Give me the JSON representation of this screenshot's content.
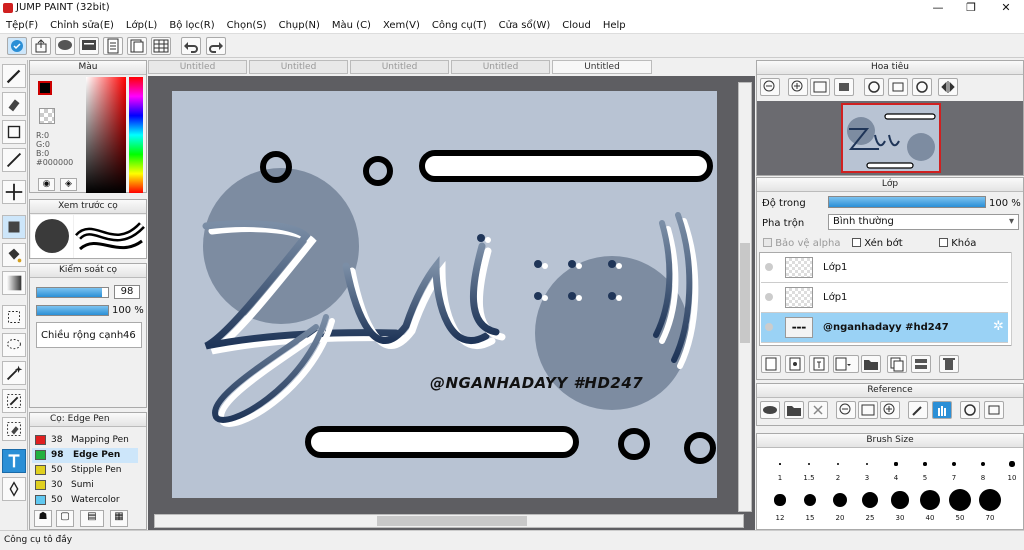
{
  "app": {
    "title": "JUMP PAINT (32bit)"
  },
  "window": {
    "minimize": "—",
    "maximize": "❐",
    "close": "✕"
  },
  "menu": [
    "Tệp(F)",
    "Chỉnh sửa(E)",
    "Lớp(L)",
    "Bộ lọc(R)",
    "Chọn(S)",
    "Chụp(N)",
    "Màu (C)",
    "Xem(V)",
    "Công cụ(T)",
    "Cửa sổ(W)",
    "Cloud",
    "Help"
  ],
  "color_panel": {
    "title": "Màu",
    "r": "R:0",
    "g": "G:0",
    "b": "B:0",
    "hex": "#000000",
    "fg": "#000000",
    "bg": "#ffffff"
  },
  "brush_preview": {
    "title": "Xem trước cọ"
  },
  "brush_control": {
    "title": "Kiểm soát cọ",
    "size": "98",
    "opacity": "100 %",
    "opacity_fill": 1.0,
    "size_fill": 0.92,
    "edge_label": "Chiều rộng cạnh",
    "edge_value": "46"
  },
  "brush_list": {
    "title": "Cọ: Edge Pen",
    "items": [
      {
        "size": "38",
        "name": "Mapping Pen",
        "color": "#e02020"
      },
      {
        "size": "98",
        "name": "Edge Pen",
        "color": "#20b040",
        "selected": true
      },
      {
        "size": "50",
        "name": "Stipple Pen",
        "color": "#e0d020"
      },
      {
        "size": "30",
        "name": "Sumi",
        "color": "#e0d020"
      },
      {
        "size": "50",
        "name": "Watercolor",
        "color": "#60c8f0"
      }
    ]
  },
  "tabs": [
    "Untitled",
    "Untitled",
    "Untitled",
    "Untitled",
    "Untitled"
  ],
  "canvas": {
    "text": "@NGANHADAYY #HD247"
  },
  "navigator": {
    "title": "Hoa tiêu"
  },
  "layer_panel": {
    "title": "Lớp",
    "opacity_label": "Độ trong",
    "opacity_value": "100 %",
    "opacity_fill": 1.0,
    "blend_label": "Pha trộn",
    "blend_value": "Bình thường",
    "protect_alpha": "Bảo vệ alpha",
    "clipping": "Xén bớt",
    "lock": "Khóa",
    "layers": [
      {
        "name": "Lớp1"
      },
      {
        "name": "Lớp1"
      },
      {
        "name": "@nganhadayy #hd247",
        "selected": true
      }
    ]
  },
  "reference": {
    "title": "Reference"
  },
  "brush_size": {
    "title": "Brush Size",
    "row1": [
      "1",
      "1.5",
      "2",
      "3",
      "4",
      "5",
      "7",
      "8",
      "10"
    ],
    "row2": [
      "12",
      "15",
      "20",
      "25",
      "30",
      "40",
      "50",
      "70"
    ]
  },
  "status": {
    "text": "Công cụ tô đầy"
  }
}
